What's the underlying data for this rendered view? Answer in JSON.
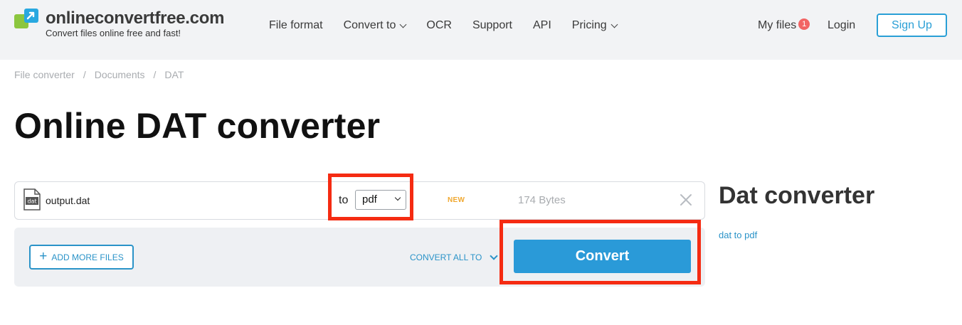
{
  "header": {
    "logo_name": "onlineconvertfree.com",
    "logo_tagline": "Convert files online free and fast!",
    "nav": [
      {
        "label": "File format",
        "has_dropdown": false
      },
      {
        "label": "Convert to",
        "has_dropdown": true
      },
      {
        "label": "OCR",
        "has_dropdown": false
      },
      {
        "label": "Support",
        "has_dropdown": false
      },
      {
        "label": "API",
        "has_dropdown": false
      },
      {
        "label": "Pricing",
        "has_dropdown": true
      }
    ],
    "my_files_label": "My files",
    "my_files_count": "1",
    "login_label": "Login",
    "signup_label": "Sign Up"
  },
  "breadcrumb": [
    "File converter",
    "Documents",
    "DAT"
  ],
  "page_title": "Online DAT converter",
  "file": {
    "icon_text": "dat",
    "name": "output.dat",
    "to_label": "to",
    "format_selected": "pdf",
    "new_label": "NEW",
    "size": "174 Bytes"
  },
  "panel": {
    "add_more_label": "ADD MORE FILES",
    "convert_all_label": "CONVERT ALL TO",
    "convert_label": "Convert"
  },
  "sidebar": {
    "title": "Dat converter",
    "links": [
      "dat to pdf"
    ]
  },
  "colors": {
    "accent": "#2a9ad8",
    "highlight": "#f52b12",
    "badge": "#f26464",
    "new_tag": "#f0a830",
    "header_bg": "#f2f3f5"
  }
}
